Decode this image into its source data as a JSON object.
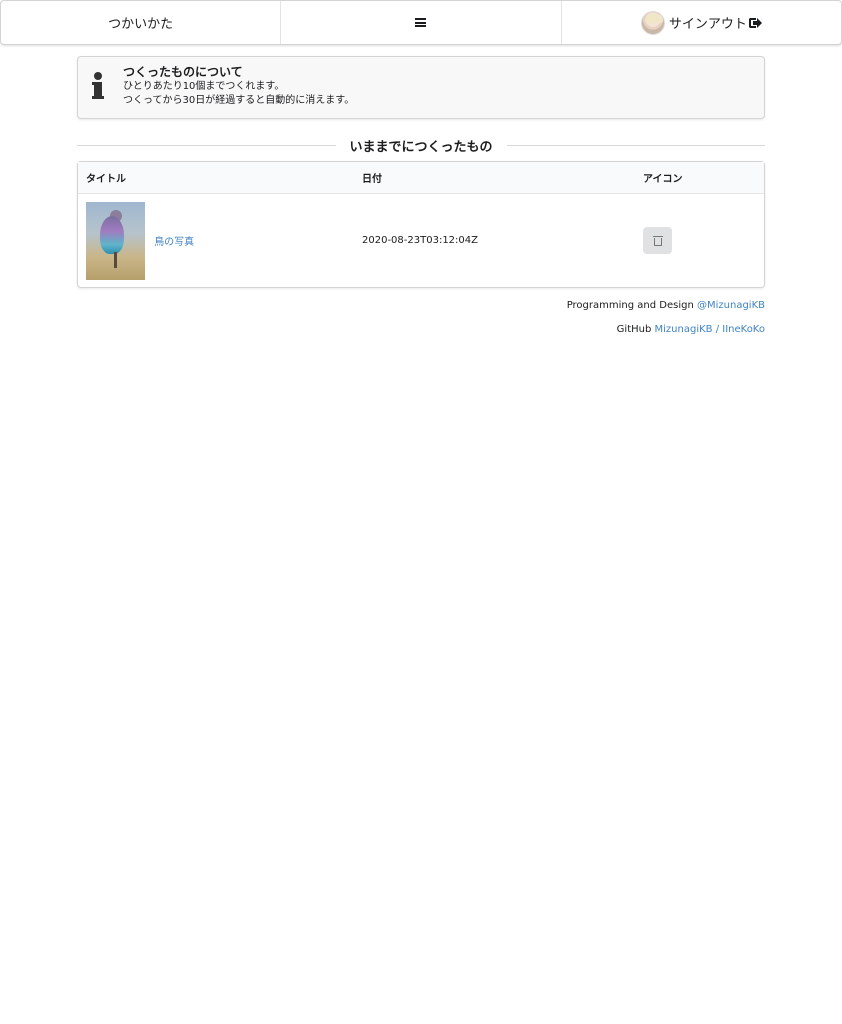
{
  "nav": {
    "usage_label": "つかいかた",
    "menu_icon": "hamburger-icon",
    "signout_label": "サインアウト",
    "signout_icon": "sign-out-icon"
  },
  "info": {
    "icon": "info-icon",
    "title": "つくったものについて",
    "lines": [
      "ひとりあたり10個までつくれます。",
      "つくってから30日が経過すると自動的に消えます。"
    ]
  },
  "section": {
    "title": "いままでにつくったもの"
  },
  "table": {
    "headers": [
      "タイトル",
      "日付",
      "アイコン"
    ],
    "rows": [
      {
        "title": "鳥の写真",
        "date": "2020-08-23T03:12:04Z",
        "action_icon": "trash-icon"
      }
    ]
  },
  "footer": {
    "line1_prefix": "Programming and Design",
    "line1_link": "@MizunagiKB",
    "line2_prefix": "GitHub",
    "line2_link": "MizunagiKB / IIneKoKo"
  },
  "colors": {
    "link": "#4183c4",
    "text": "#1b1c1d",
    "info_bg": "#f8f8f9",
    "button_bg": "#e0e1e2"
  }
}
